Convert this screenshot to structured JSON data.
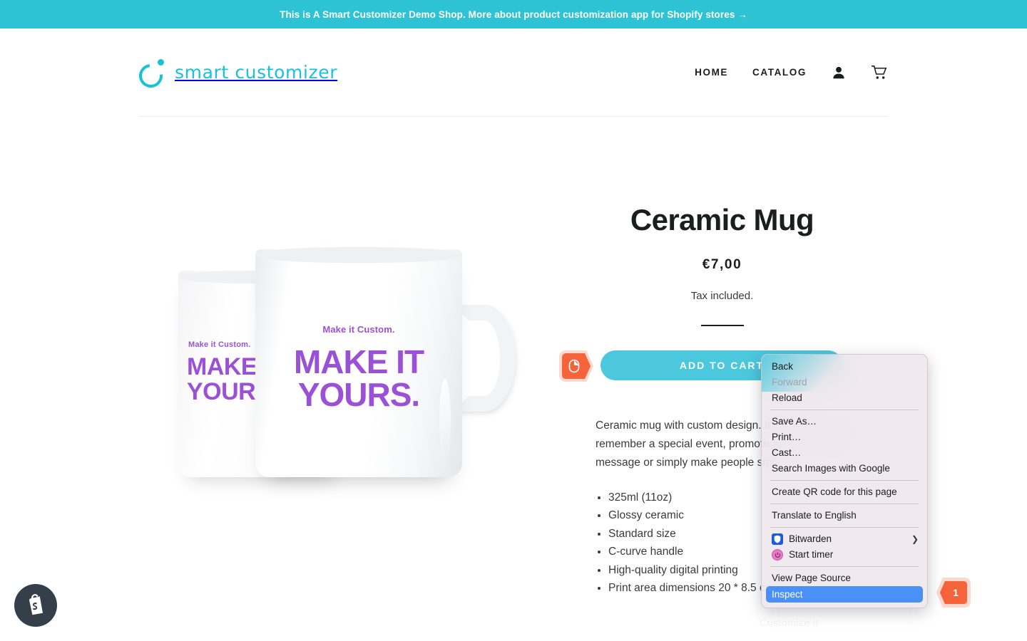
{
  "announcement": {
    "text": "This is A Smart Customizer Demo Shop. More about product customization app for Shopify stores →"
  },
  "header": {
    "logo_text": "smart customizer",
    "logo_icon": "ring-dot-logo-icon",
    "nav": [
      {
        "label": "HOME"
      },
      {
        "label": "CATALOG"
      }
    ],
    "account_icon": "user-account-icon",
    "cart_icon": "shopping-cart-icon"
  },
  "product": {
    "title": "Ceramic Mug",
    "price": "€7,00",
    "tax_note": "Tax included.",
    "add_to_cart_label": "ADD TO CART",
    "description": "Ceramic mug with custom design. It is a great way to remember a special event, promote a brand, pass a message or simply make people smile.",
    "features": [
      "325ml (11oz)",
      "Glossy ceramic",
      "Standard size",
      "C-curve handle",
      "High-quality digital printing",
      "Print area dimensions 20 * 8.5 cm"
    ],
    "footer_note": "Customize it",
    "image": {
      "alt": "ceramic-mug-product-photo",
      "mug_subtitle": "Make it Custom.",
      "mug_headline_line1": "MAKE IT",
      "mug_headline_line2": "YOURS.",
      "print_color": "#9b51d6"
    }
  },
  "chat_widget": {
    "icon": "shopify-bag-icon"
  },
  "context_menu": {
    "items": [
      {
        "label": "Back",
        "state": "enabled"
      },
      {
        "label": "Forward",
        "state": "disabled"
      },
      {
        "label": "Reload",
        "state": "enabled"
      },
      {
        "separator": true
      },
      {
        "label": "Save As…",
        "state": "enabled"
      },
      {
        "label": "Print…",
        "state": "enabled"
      },
      {
        "label": "Cast…",
        "state": "enabled"
      },
      {
        "label": "Search Images with Google",
        "state": "enabled"
      },
      {
        "separator": true
      },
      {
        "label": "Create QR code for this page",
        "state": "enabled"
      },
      {
        "separator": true
      },
      {
        "label": "Translate to English",
        "state": "enabled"
      },
      {
        "separator": true
      },
      {
        "label": "Bitwarden",
        "state": "enabled",
        "icon": "bitwarden-shield-icon",
        "submenu": true
      },
      {
        "label": "Start timer",
        "state": "enabled",
        "icon": "timer-power-icon"
      },
      {
        "separator": true
      },
      {
        "label": "View Page Source",
        "state": "enabled"
      },
      {
        "label": "Inspect",
        "state": "highlighted"
      }
    ]
  },
  "markers": {
    "click_marker": {
      "icon": "right-click-mouse-icon"
    },
    "step_badge": {
      "number": "1"
    }
  },
  "colors": {
    "brand_cyan": "#2dc2d4",
    "button_cyan": "#4cc8dd",
    "logo_cyan": "#19c2d8",
    "marker_orange": "#f4633a",
    "highlight_blue": "#4a90f7",
    "print_purple": "#9b51d6"
  }
}
